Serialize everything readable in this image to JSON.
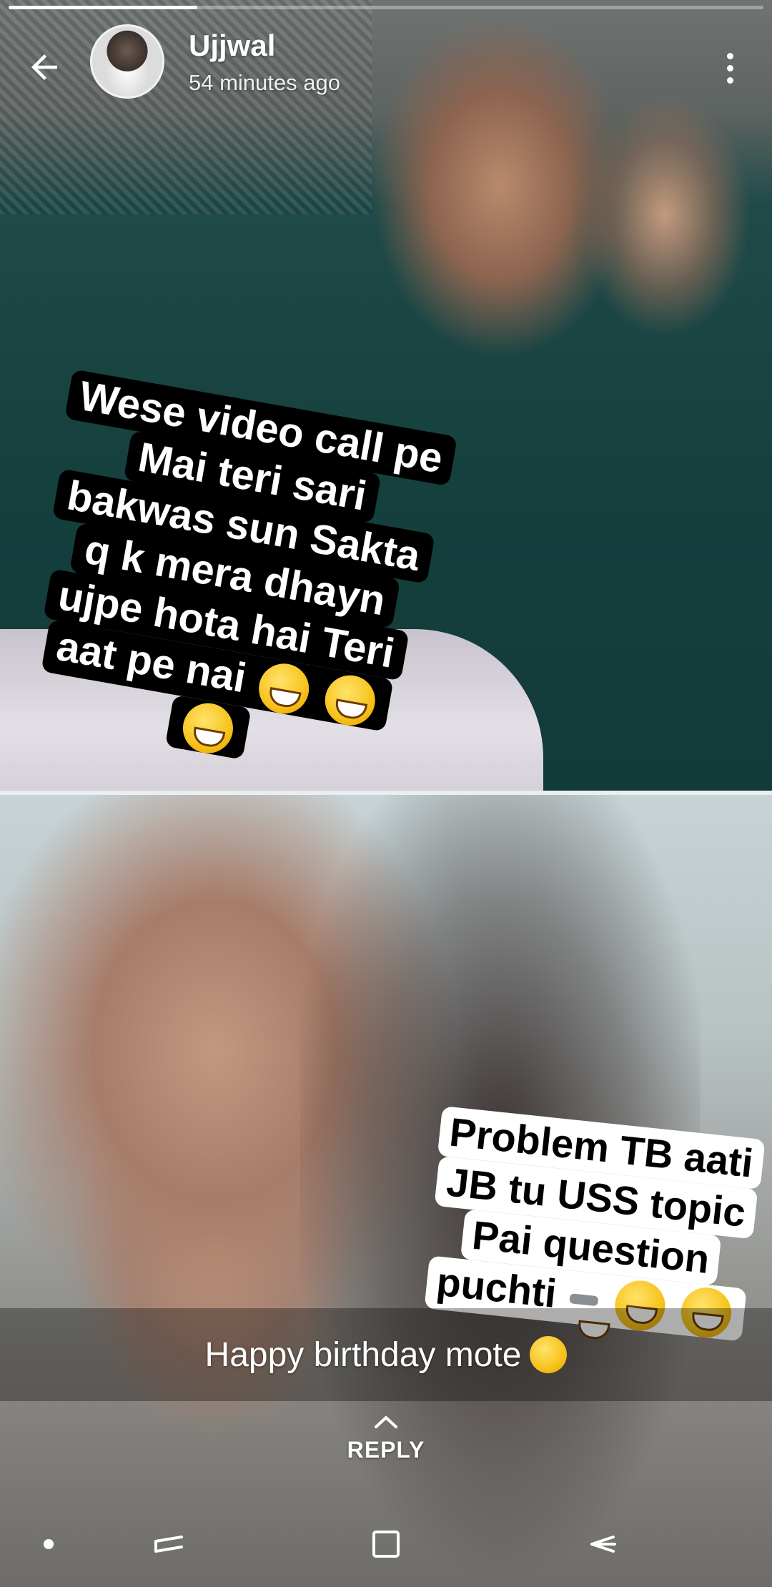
{
  "header": {
    "contact_name": "Ujjwal",
    "timestamp": "54 minutes ago",
    "back_icon": "arrow-left-icon",
    "menu_icon": "more-vertical-icon"
  },
  "story": {
    "progress": 0.25,
    "sticker_top": {
      "lines": [
        "Wese video call pe",
        "Mai teri sari",
        "bakwas sun Sakta",
        "q k mera dhayn",
        "ujpe hota hai Teri",
        "aat pe nai"
      ]
    },
    "sticker_bottom": {
      "lines": [
        "Problem TB aati",
        "JB tu USS topic",
        "Pai question",
        "puchti"
      ]
    },
    "caption": "Happy birthday mote"
  },
  "reply": {
    "label": "REPLY",
    "icon": "chevron-up-icon"
  },
  "navbar": {
    "items": [
      "dot-indicator-icon",
      "recent-apps-icon",
      "home-icon",
      "back-icon"
    ]
  },
  "colors": {
    "text": "#ffffff",
    "sticker_dark": "#000000",
    "sticker_light": "#ffffff"
  }
}
